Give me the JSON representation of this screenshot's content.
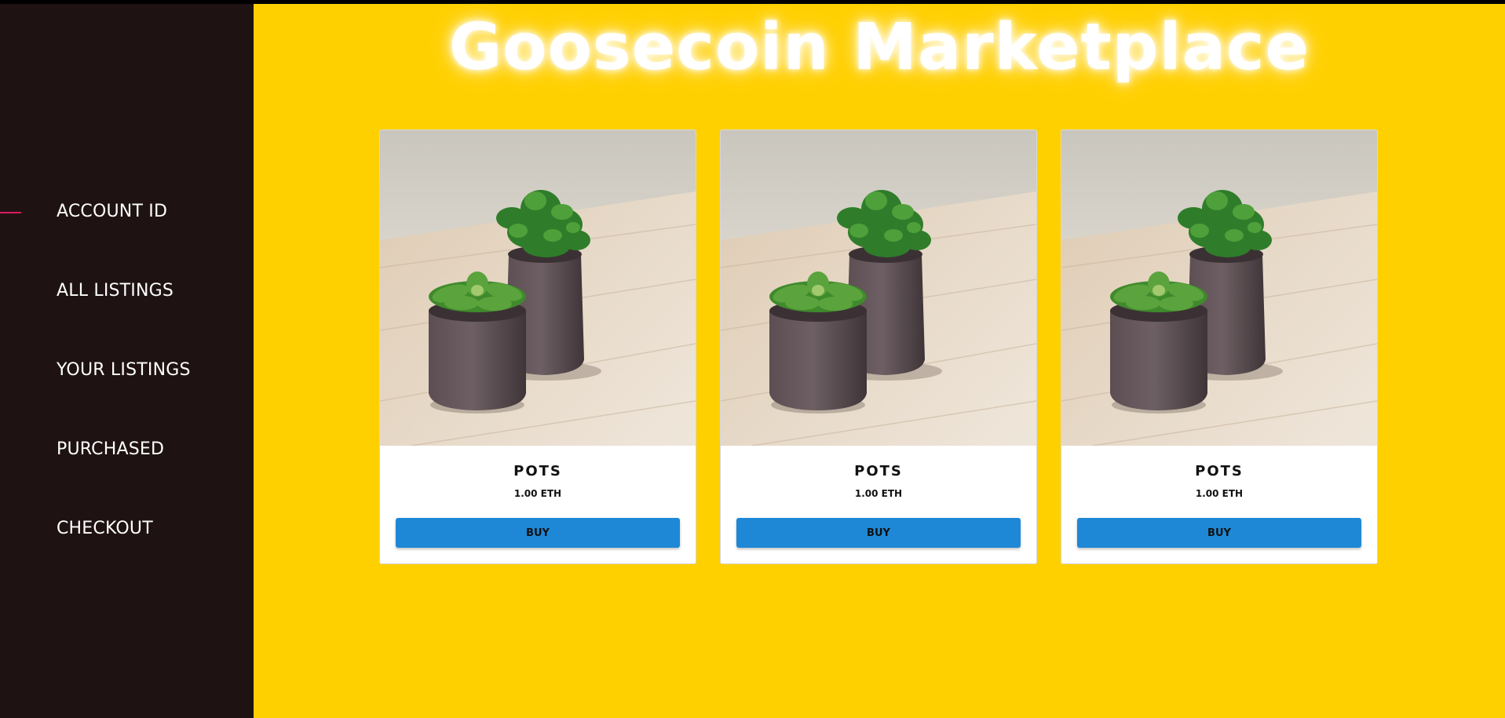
{
  "app": {
    "title": "Goosecoin Marketplace"
  },
  "sidebar": {
    "items": [
      {
        "label": "ACCOUNT ID",
        "active": true
      },
      {
        "label": "ALL LISTINGS",
        "active": false
      },
      {
        "label": "YOUR LISTINGS",
        "active": false
      },
      {
        "label": "PURCHASED",
        "active": false
      },
      {
        "label": "CHECKOUT",
        "active": false
      }
    ]
  },
  "listings": [
    {
      "name": "POTS",
      "price": "1.00 ETH",
      "button_label": "BUY",
      "image": "succulent-pots-photo"
    },
    {
      "name": "POTS",
      "price": "1.00 ETH",
      "button_label": "BUY",
      "image": "succulent-pots-photo"
    },
    {
      "name": "POTS",
      "price": "1.00 ETH",
      "button_label": "BUY",
      "image": "succulent-pots-photo"
    }
  ],
  "colors": {
    "sidebar_bg": "#1f1213",
    "main_bg": "#ffd000",
    "active_marker": "#d81b60",
    "button_bg": "#1e88d6"
  }
}
